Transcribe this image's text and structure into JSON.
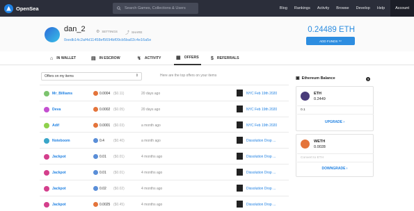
{
  "nav": {
    "brand": "OpenSea",
    "search_placeholder": "Search Games, Collections & Users",
    "links": [
      "Blog",
      "Rankings",
      "Activity",
      "Browse",
      "Develop",
      "Help"
    ],
    "account": "Account"
  },
  "profile": {
    "username": "dan_2",
    "settings": "SETTINGS",
    "share": "SHARE",
    "address": "0xedb14c2af4d11458ef5694bf09cb5ba02c4e16a5e",
    "balance": "0.24489 ETH",
    "add_funds": "ADD FUNDS"
  },
  "tabs": [
    {
      "label": "IN WALLET",
      "icon": "tag-icon"
    },
    {
      "label": "IN ESCROW",
      "icon": "document-icon"
    },
    {
      "label": "ACTIVITY",
      "icon": "activity-icon"
    },
    {
      "label": "OFFERS",
      "icon": "gift-icon"
    },
    {
      "label": "REFERRALS",
      "icon": "dollar-icon"
    }
  ],
  "offers": {
    "filter": "Offers on my items",
    "hint": "Here are the top offers on your items",
    "rows": [
      {
        "user": "Mr_Billiams",
        "amount": "0.0004",
        "usd": "($0.11)",
        "time": "20 days ago",
        "item": "NYC Feb 19th 2020",
        "avatar_color": "#7cc36e",
        "coin": "weth"
      },
      {
        "user": "Deva",
        "amount": "0.0002",
        "usd": "($0.05)",
        "time": "20 days ago",
        "item": "NYC Feb 19th 2020",
        "avatar_color": "#c44fd0",
        "coin": "weth"
      },
      {
        "user": "Adif",
        "amount": "0.0001",
        "usd": "($0.03)",
        "time": "a month ago",
        "item": "NYC Feb 19th 2020",
        "avatar_color": "#8ed14c",
        "coin": "weth"
      },
      {
        "user": "Noteboom",
        "amount": "0.4",
        "usd": "($0.40)",
        "time": "a month ago",
        "item": "Dissolution Drop ...",
        "avatar_color": "#3aa6c9",
        "coin": "dai"
      },
      {
        "user": "Jackpot",
        "amount": "0.01",
        "usd": "($0.01)",
        "time": "4 months ago",
        "item": "Dissolution Drop ...",
        "avatar_color": "#d43f8c",
        "coin": "dai"
      },
      {
        "user": "Jackpot",
        "amount": "0.01",
        "usd": "($0.01)",
        "time": "4 months ago",
        "item": "Dissolution Drop ...",
        "avatar_color": "#d43f8c",
        "coin": "dai"
      },
      {
        "user": "Jackpot",
        "amount": "0.02",
        "usd": "($0.02)",
        "time": "4 months ago",
        "item": "Dissolution Drop ...",
        "avatar_color": "#d43f8c",
        "coin": "dai"
      },
      {
        "user": "Jackpot",
        "amount": "0.0025",
        "usd": "($0.45)",
        "time": "4 months ago",
        "item": "Dissolution Drop ...",
        "avatar_color": "#d43f8c",
        "coin": "weth"
      }
    ]
  },
  "wallet": {
    "title": "Ethereum Balance",
    "help": "?",
    "eth": {
      "symbol": "ETH",
      "value": "0.2449",
      "input_value": "0.1",
      "action": "UPGRADE ›"
    },
    "weth": {
      "symbol": "WETH",
      "value": "0.0028",
      "input_placeholder": "Convert to ETH",
      "action": "DOWNGRADE ›"
    }
  },
  "colors": {
    "nav_bg": "#2b2e3a",
    "accent": "#2081e2",
    "weth": "#e4743b",
    "dai": "#5a8ed8"
  }
}
